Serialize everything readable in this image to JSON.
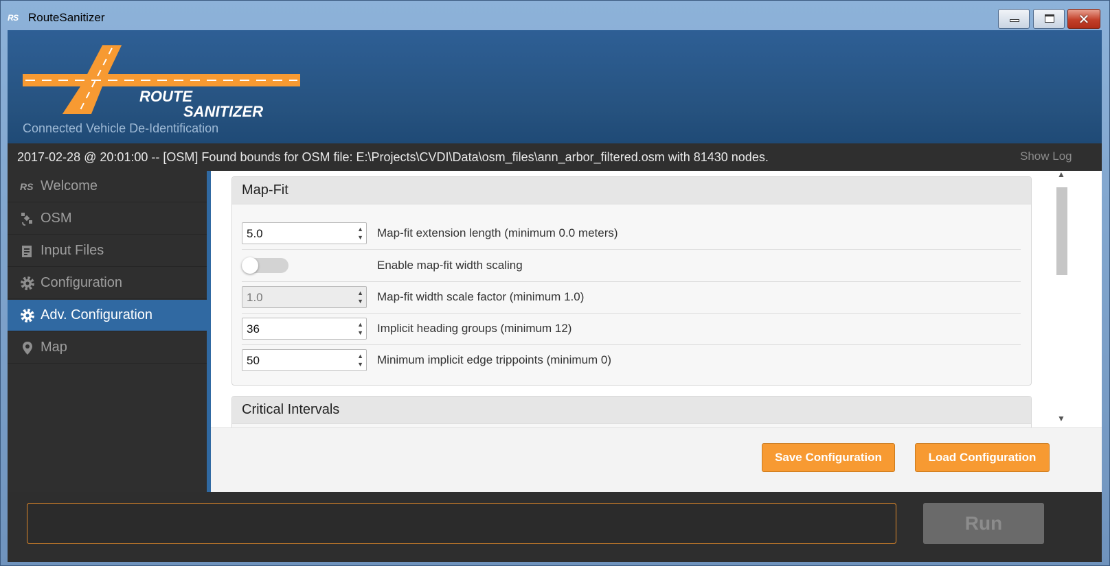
{
  "window": {
    "title_icon": "RS",
    "title": "RouteSanitizer",
    "controls": [
      "minimize-icon",
      "maximize-icon",
      "close-icon"
    ],
    "close_glyph": "✕"
  },
  "header": {
    "logo_line1": "ROUTE",
    "logo_line2": "SANITIZER",
    "subtitle": "Connected Vehicle De-Identification"
  },
  "status": {
    "message": "2017-02-28 @ 20:01:00 -- [OSM] Found bounds for OSM file: E:\\Projects\\CVDI\\Data\\osm_files\\ann_arbor_filtered.osm with 81430 nodes.",
    "show_log": "Show Log"
  },
  "sidebar": {
    "items": [
      {
        "label": "Welcome",
        "icon": "rs-icon",
        "icon_text": "RS",
        "active": false
      },
      {
        "label": "OSM",
        "icon": "satellite-icon",
        "active": false
      },
      {
        "label": "Input Files",
        "icon": "files-icon",
        "active": false
      },
      {
        "label": "Configuration",
        "icon": "gear-icon",
        "active": false
      },
      {
        "label": "Adv. Configuration",
        "icon": "gear-icon",
        "active": true
      },
      {
        "label": "Map",
        "icon": "map-marker-icon",
        "active": false
      }
    ]
  },
  "mapfit": {
    "title": "Map-Fit",
    "rows": [
      {
        "type": "number",
        "value": "5.0",
        "label": "Map-fit extension length (minimum 0.0 meters)",
        "disabled": false
      },
      {
        "type": "toggle",
        "checked": false,
        "label": "Enable map-fit width scaling"
      },
      {
        "type": "number",
        "value": "1.0",
        "label": "Map-fit width scale factor (minimum 1.0)",
        "disabled": true
      },
      {
        "type": "number",
        "value": "36",
        "label": "Implicit heading groups (minimum 12)",
        "disabled": false
      },
      {
        "type": "number",
        "value": "50",
        "label": "Minimum implicit edge trippoints (minimum 0)",
        "disabled": false
      }
    ]
  },
  "critical": {
    "title": "Critical Intervals"
  },
  "buttons": {
    "save": "Save Configuration",
    "load": "Load Configuration",
    "run": "Run"
  },
  "command": {
    "value": ""
  },
  "colors": {
    "accent_orange": "#f79a32",
    "header_blue": "#2e5f95",
    "active_nav": "#3069a2",
    "dark_bg": "#2e2e2e"
  }
}
